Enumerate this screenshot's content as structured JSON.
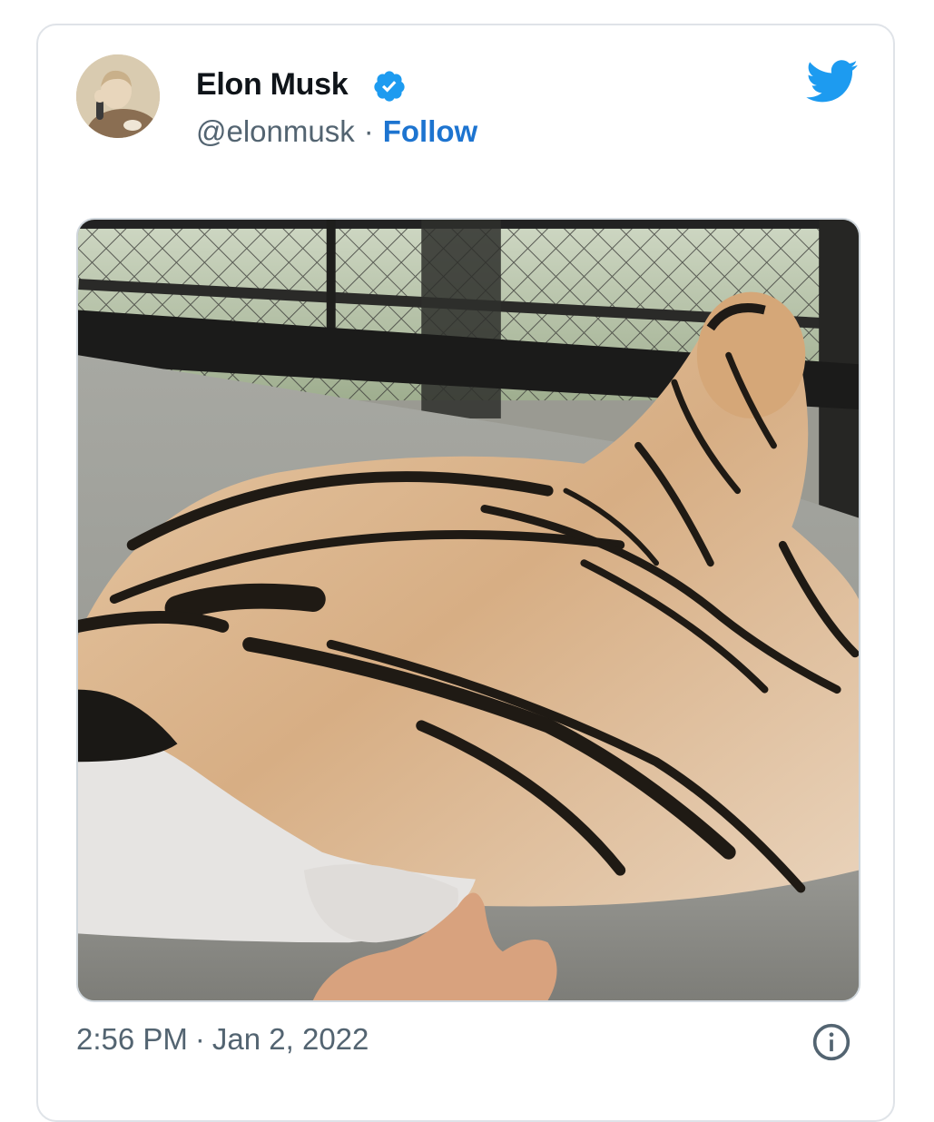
{
  "tweet": {
    "author_name": "Elon Musk",
    "handle": "@elonmusk",
    "separator": "·",
    "follow_label": "Follow",
    "time": "2:56 PM",
    "date": "Jan 2, 2022",
    "verified": true
  },
  "icons": {
    "brand": "twitter-bird-icon",
    "verified": "verified-badge-icon",
    "info": "info-icon"
  },
  "colors": {
    "twitter_blue": "#1d9bf0",
    "follow_link": "#1d74d0",
    "verified_badge": "#1d9bf0",
    "muted_text": "#536471"
  }
}
